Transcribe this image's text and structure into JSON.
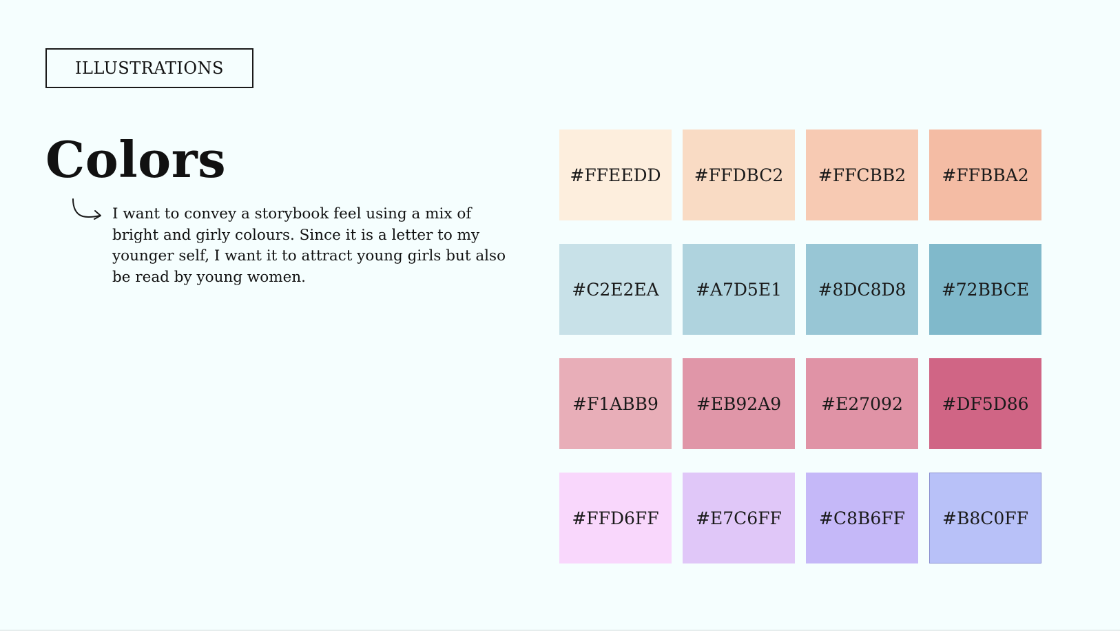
{
  "header": {
    "tag_label": "ILLUSTRATIONS"
  },
  "main": {
    "title": "Colors",
    "description": "I want to convey a storybook feel using a mix of bright and girly colours. Since it is a letter to my younger self, I want it to attract young girls but also be read by young women.",
    "arrow_icon": "curved-arrow-icon"
  },
  "palette": {
    "swatches": [
      {
        "label": "#FFEEDD",
        "color": "#fdeedd"
      },
      {
        "label": "#FFDBC2",
        "color": "#f9dbc4"
      },
      {
        "label": "#FFCBB2",
        "color": "#f7cab3"
      },
      {
        "label": "#FFBBA2",
        "color": "#f4bca4"
      },
      {
        "label": "#C2E2EA",
        "color": "#c8e1e8"
      },
      {
        "label": "#A7D5E1",
        "color": "#afd3de"
      },
      {
        "label": "#8DC8D8",
        "color": "#98c6d5"
      },
      {
        "label": "#72BBCE",
        "color": "#80b9cb"
      },
      {
        "label": "#F1ABB9",
        "color": "#e8aeb8"
      },
      {
        "label": "#EB92A9",
        "color": "#e096a8"
      },
      {
        "label": "#E27092",
        "color": "#e093a6"
      },
      {
        "label": "#DF5D86",
        "color": "#d06585"
      },
      {
        "label": "#FFD6FF",
        "color": "#f9d7fc"
      },
      {
        "label": "#E7C6FF",
        "color": "#e0c7f8"
      },
      {
        "label": "#C8B6FF",
        "color": "#c5b8f8"
      },
      {
        "label": "#B8C0FF",
        "color": "#b8c1f8"
      }
    ]
  }
}
